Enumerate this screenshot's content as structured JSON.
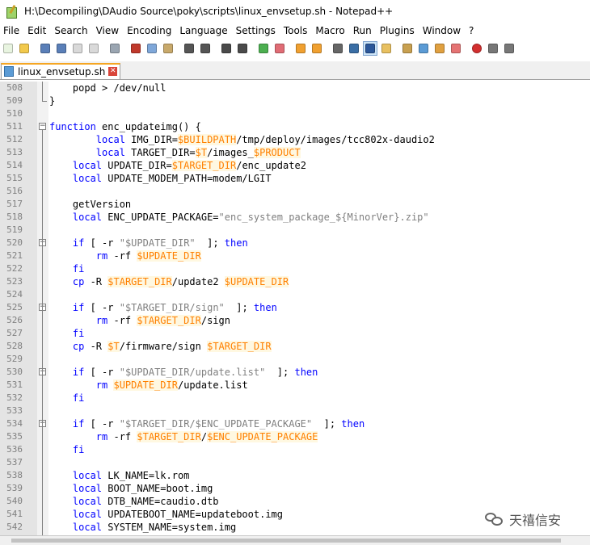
{
  "window": {
    "title": "H:\\Decompiling\\DAudio Source\\poky\\scripts\\linux_envsetup.sh - Notepad++"
  },
  "menu": [
    "File",
    "Edit",
    "Search",
    "View",
    "Encoding",
    "Language",
    "Settings",
    "Tools",
    "Macro",
    "Run",
    "Plugins",
    "Window",
    "?"
  ],
  "toolbar_icons": [
    "new-file-icon",
    "open-file-icon",
    "save-icon",
    "save-all-icon",
    "close-icon",
    "close-all-icon",
    "print-icon",
    "cut-icon",
    "copy-icon",
    "paste-icon",
    "undo-icon",
    "redo-icon",
    "find-icon",
    "replace-icon",
    "zoom-in-icon",
    "zoom-out-icon",
    "sync-vertical-icon",
    "sync-horizontal-icon",
    "word-wrap-icon",
    "show-all-chars-icon",
    "indent-guide-icon",
    "user-lang-icon",
    "doc-map-icon",
    "function-list-icon",
    "folder-workspace-icon",
    "monitor-icon",
    "record-macro-icon",
    "stop-macro-icon",
    "play-macro-icon"
  ],
  "tab": {
    "label": "linux_envsetup.sh",
    "close": "✕"
  },
  "watermark": "天禧信安",
  "lines": [
    {
      "n": "508",
      "t": [
        [
          "",
          "    popd > /dev/null"
        ]
      ]
    },
    {
      "n": "509",
      "t": [
        [
          "",
          "}"
        ]
      ]
    },
    {
      "n": "510",
      "t": []
    },
    {
      "n": "511",
      "t": [
        [
          "kw",
          "function"
        ],
        [
          "",
          " enc_updateimg() {"
        ]
      ]
    },
    {
      "n": "512",
      "t": [
        [
          "",
          "        "
        ],
        [
          "kw",
          "local"
        ],
        [
          "",
          " IMG_DIR="
        ],
        [
          "var",
          "$BUILDPATH"
        ],
        [
          "",
          "/tmp/deploy/images/tcc802x-daudio2"
        ]
      ]
    },
    {
      "n": "513",
      "t": [
        [
          "",
          "        "
        ],
        [
          "kw",
          "local"
        ],
        [
          "",
          " TARGET_DIR="
        ],
        [
          "var",
          "$T"
        ],
        [
          "",
          "/images_"
        ],
        [
          "var",
          "$PRODUCT"
        ]
      ]
    },
    {
      "n": "514",
      "t": [
        [
          "",
          "    "
        ],
        [
          "kw",
          "local"
        ],
        [
          "",
          " UPDATE_DIR="
        ],
        [
          "var",
          "$TARGET_DIR"
        ],
        [
          "",
          "/enc_update2"
        ]
      ]
    },
    {
      "n": "515",
      "t": [
        [
          "",
          "    "
        ],
        [
          "kw",
          "local"
        ],
        [
          "",
          " UPDATE_MODEM_PATH=modem/LGIT"
        ]
      ]
    },
    {
      "n": "516",
      "t": []
    },
    {
      "n": "517",
      "t": [
        [
          "",
          "    getVersion"
        ]
      ]
    },
    {
      "n": "518",
      "t": [
        [
          "",
          "    "
        ],
        [
          "kw",
          "local"
        ],
        [
          "",
          " ENC_UPDATE_PACKAGE="
        ],
        [
          "str",
          "\"enc_system_package_${MinorVer}.zip\""
        ]
      ]
    },
    {
      "n": "519",
      "t": []
    },
    {
      "n": "520",
      "t": [
        [
          "",
          "    "
        ],
        [
          "kw",
          "if"
        ],
        [
          "",
          " [ -r "
        ],
        [
          "str",
          "\"$UPDATE_DIR\""
        ],
        [
          "",
          "  ]; "
        ],
        [
          "kw",
          "then"
        ]
      ]
    },
    {
      "n": "521",
      "t": [
        [
          "",
          "        "
        ],
        [
          "kw",
          "rm"
        ],
        [
          "",
          " -rf "
        ],
        [
          "var",
          "$UPDATE_DIR"
        ]
      ]
    },
    {
      "n": "522",
      "t": [
        [
          "",
          "    "
        ],
        [
          "kw",
          "fi"
        ]
      ]
    },
    {
      "n": "523",
      "t": [
        [
          "",
          "    "
        ],
        [
          "kw",
          "cp"
        ],
        [
          "",
          " -R "
        ],
        [
          "var",
          "$TARGET_DIR"
        ],
        [
          "",
          "/update2 "
        ],
        [
          "var",
          "$UPDATE_DIR"
        ]
      ]
    },
    {
      "n": "524",
      "t": []
    },
    {
      "n": "525",
      "t": [
        [
          "",
          "    "
        ],
        [
          "kw",
          "if"
        ],
        [
          "",
          " [ -r "
        ],
        [
          "str",
          "\"$TARGET_DIR/sign\""
        ],
        [
          "",
          "  ]; "
        ],
        [
          "kw",
          "then"
        ]
      ]
    },
    {
      "n": "526",
      "t": [
        [
          "",
          "        "
        ],
        [
          "kw",
          "rm"
        ],
        [
          "",
          " -rf "
        ],
        [
          "var",
          "$TARGET_DIR"
        ],
        [
          "",
          "/sign"
        ]
      ]
    },
    {
      "n": "527",
      "t": [
        [
          "",
          "    "
        ],
        [
          "kw",
          "fi"
        ]
      ]
    },
    {
      "n": "528",
      "t": [
        [
          "",
          "    "
        ],
        [
          "kw",
          "cp"
        ],
        [
          "",
          " -R "
        ],
        [
          "var",
          "$T"
        ],
        [
          "",
          "/firmware/sign "
        ],
        [
          "var",
          "$TARGET_DIR"
        ]
      ]
    },
    {
      "n": "529",
      "t": []
    },
    {
      "n": "530",
      "t": [
        [
          "",
          "    "
        ],
        [
          "kw",
          "if"
        ],
        [
          "",
          " [ -r "
        ],
        [
          "str",
          "\"$UPDATE_DIR/update.list\""
        ],
        [
          "",
          "  ]; "
        ],
        [
          "kw",
          "then"
        ]
      ]
    },
    {
      "n": "531",
      "t": [
        [
          "",
          "        "
        ],
        [
          "kw",
          "rm"
        ],
        [
          "",
          " "
        ],
        [
          "var",
          "$UPDATE_DIR"
        ],
        [
          "",
          "/update.list"
        ]
      ]
    },
    {
      "n": "532",
      "t": [
        [
          "",
          "    "
        ],
        [
          "kw",
          "fi"
        ]
      ]
    },
    {
      "n": "533",
      "t": []
    },
    {
      "n": "534",
      "t": [
        [
          "",
          "    "
        ],
        [
          "kw",
          "if"
        ],
        [
          "",
          " [ -r "
        ],
        [
          "str",
          "\"$TARGET_DIR/$ENC_UPDATE_PACKAGE\""
        ],
        [
          "",
          "  ]; "
        ],
        [
          "kw",
          "then"
        ]
      ]
    },
    {
      "n": "535",
      "t": [
        [
          "",
          "        "
        ],
        [
          "kw",
          "rm"
        ],
        [
          "",
          " -rf "
        ],
        [
          "var",
          "$TARGET_DIR"
        ],
        [
          "",
          "/"
        ],
        [
          "var",
          "$ENC_UPDATE_PACKAGE"
        ]
      ]
    },
    {
      "n": "536",
      "t": [
        [
          "",
          "    "
        ],
        [
          "kw",
          "fi"
        ]
      ]
    },
    {
      "n": "537",
      "t": []
    },
    {
      "n": "538",
      "t": [
        [
          "",
          "    "
        ],
        [
          "kw",
          "local"
        ],
        [
          "",
          " LK_NAME=lk.rom"
        ]
      ]
    },
    {
      "n": "539",
      "t": [
        [
          "",
          "    "
        ],
        [
          "kw",
          "local"
        ],
        [
          "",
          " BOOT_NAME=boot.img"
        ]
      ]
    },
    {
      "n": "540",
      "t": [
        [
          "",
          "    "
        ],
        [
          "kw",
          "local"
        ],
        [
          "",
          " DTB_NAME=caudio.dtb"
        ]
      ]
    },
    {
      "n": "541",
      "t": [
        [
          "",
          "    "
        ],
        [
          "kw",
          "local"
        ],
        [
          "",
          " UPDATEBOOT_NAME=updateboot.img"
        ]
      ]
    },
    {
      "n": "542",
      "t": [
        [
          "",
          "    "
        ],
        [
          "kw",
          "local"
        ],
        [
          "",
          " SYSTEM_NAME=system.img"
        ]
      ]
    }
  ]
}
